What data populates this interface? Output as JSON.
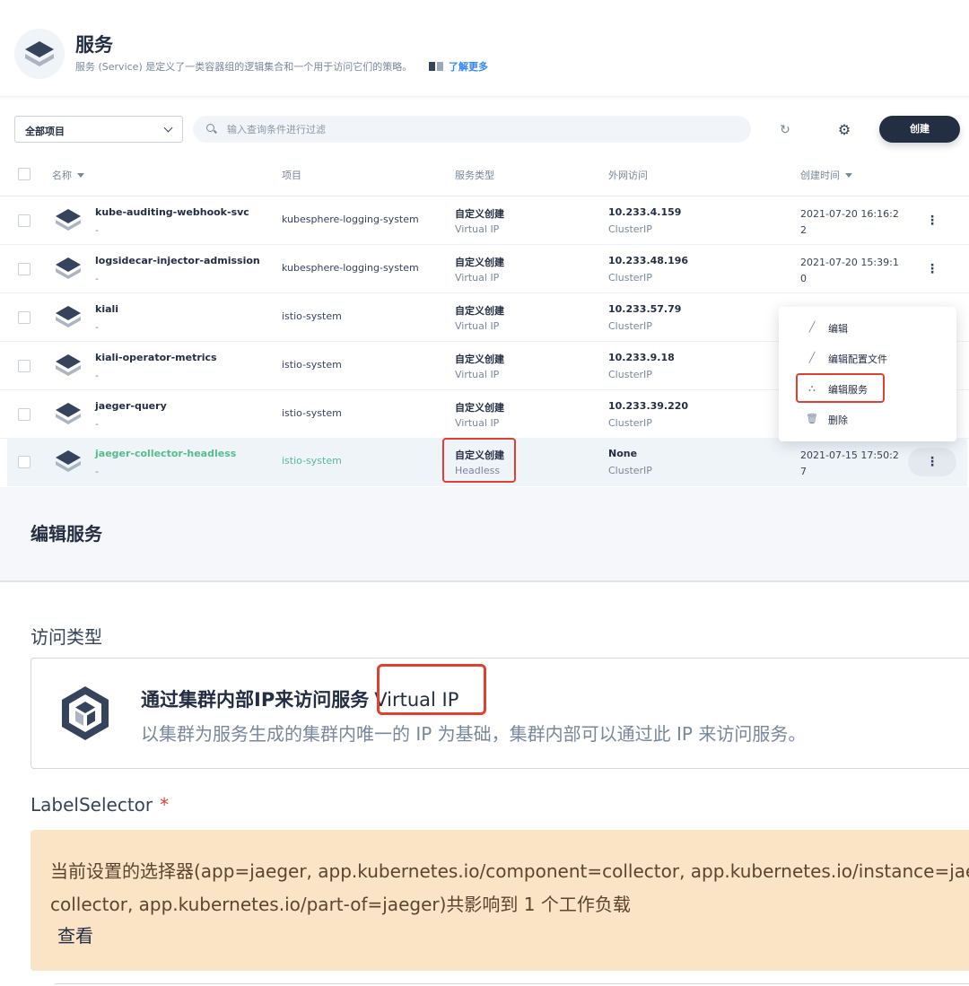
{
  "header": {
    "title": "服务",
    "description": "服务 (Service) 是定义了一类容器组的逻辑集合和一个用于访问它们的策略。",
    "learn_more": "了解更多"
  },
  "toolbar": {
    "project_select": "全部项目",
    "search_placeholder": "输入查询条件进行过滤",
    "create_label": "创建"
  },
  "table": {
    "columns": [
      "名称",
      "项目",
      "服务类型",
      "外网访问",
      "创建时间"
    ],
    "rows": [
      {
        "name": "kube-auditing-webhook-svc",
        "sub": "-",
        "project": "kubesphere-logging-system",
        "type": "自定义创建",
        "type_sub": "Virtual IP",
        "ip": "10.233.4.159",
        "ip_sub": "ClusterIP",
        "time": "2021-07-20 16:16:22"
      },
      {
        "name": "logsidecar-injector-admission",
        "sub": "-",
        "project": "kubesphere-logging-system",
        "type": "自定义创建",
        "type_sub": "Virtual IP",
        "ip": "10.233.48.196",
        "ip_sub": "ClusterIP",
        "time": "2021-07-20 15:39:10"
      },
      {
        "name": "kiali",
        "sub": "-",
        "project": "istio-system",
        "type": "自定义创建",
        "type_sub": "Virtual IP",
        "ip": "10.233.57.79",
        "ip_sub": "ClusterIP",
        "time": ""
      },
      {
        "name": "kiali-operator-metrics",
        "sub": "-",
        "project": "istio-system",
        "type": "自定义创建",
        "type_sub": "Virtual IP",
        "ip": "10.233.9.18",
        "ip_sub": "ClusterIP",
        "time": ""
      },
      {
        "name": "jaeger-query",
        "sub": "-",
        "project": "istio-system",
        "type": "自定义创建",
        "type_sub": "Virtual IP",
        "ip": "10.233.39.220",
        "ip_sub": "ClusterIP",
        "time": ""
      },
      {
        "name": "jaeger-collector-headless",
        "sub": "-",
        "project": "istio-system",
        "type": "自定义创建",
        "type_sub": "Headless",
        "ip": "None",
        "ip_sub": "ClusterIP",
        "time": "2021-07-15 17:50:27"
      }
    ]
  },
  "menu": {
    "items": [
      "编辑",
      "编辑配置文件",
      "编辑服务",
      "删除"
    ]
  },
  "edit_panel": {
    "title": "编辑服务",
    "access_type_label": "访问类型",
    "card_title": "通过集群内部IP来访问服务",
    "card_title_tag": "Virtual IP",
    "card_desc": "以集群为服务生成的集群内唯一的 IP 为基础，集群内部可以通过此 IP 来访问服务。",
    "selector_label": "LabelSelector",
    "required_mark": "*",
    "selector_line1": "当前设置的选择器(app=jaeger, app.kubernetes.io/component=collector, app.kubernetes.io/instance=jaeger-",
    "selector_line2": "collector, app.kubernetes.io/part-of=jaeger)共影响到 1 个工作负载",
    "view_link": "查看"
  },
  "colors": {
    "primary": "#242e42",
    "success": "#55bc8a",
    "highlight_border": "#e0402f",
    "warning_bg": "#fbe3c5"
  }
}
